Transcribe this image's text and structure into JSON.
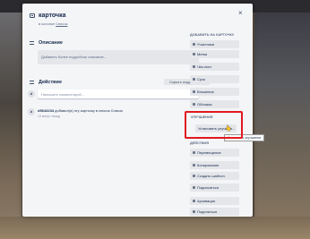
{
  "card": {
    "title": "карточка",
    "list_prefix": "в колонке",
    "list_name": "Список",
    "close": "×"
  },
  "description": {
    "heading": "Описание",
    "placeholder": "Добавить более подробное описание..."
  },
  "activity": {
    "heading": "Действие",
    "hide_details": "Скрыть подробности",
    "avatar_initial": "d",
    "comment_placeholder": "Напишите комментарий...",
    "entries": [
      {
        "user": "d5643234",
        "text": "добавил(а) эту карточку в список Список",
        "time": "13 минут назад"
      }
    ]
  },
  "sidebar": {
    "add_heading": "ДОБАВИТЬ НА КАРТОЧКУ",
    "add_items": [
      "Участники",
      "Метки",
      "Чек-лист",
      "Срок",
      "Вложение",
      "Обложка"
    ],
    "upgrades_heading": "УЛУЧШЕНИЯ",
    "upgrade_button": "Установить улучшен...",
    "upgrade_tooltip": "Установить улучшения",
    "actions_heading": "ДЕЙСТВИЯ",
    "action_items": [
      "Перемещение",
      "Копирование",
      "Создать шаблон",
      "Подписаться",
      "Архивация",
      "Поделиться"
    ]
  },
  "colors": {
    "highlight": "#e0191f",
    "modal_bg": "#f4f5f7",
    "button_bg": "#e4e6ea"
  }
}
